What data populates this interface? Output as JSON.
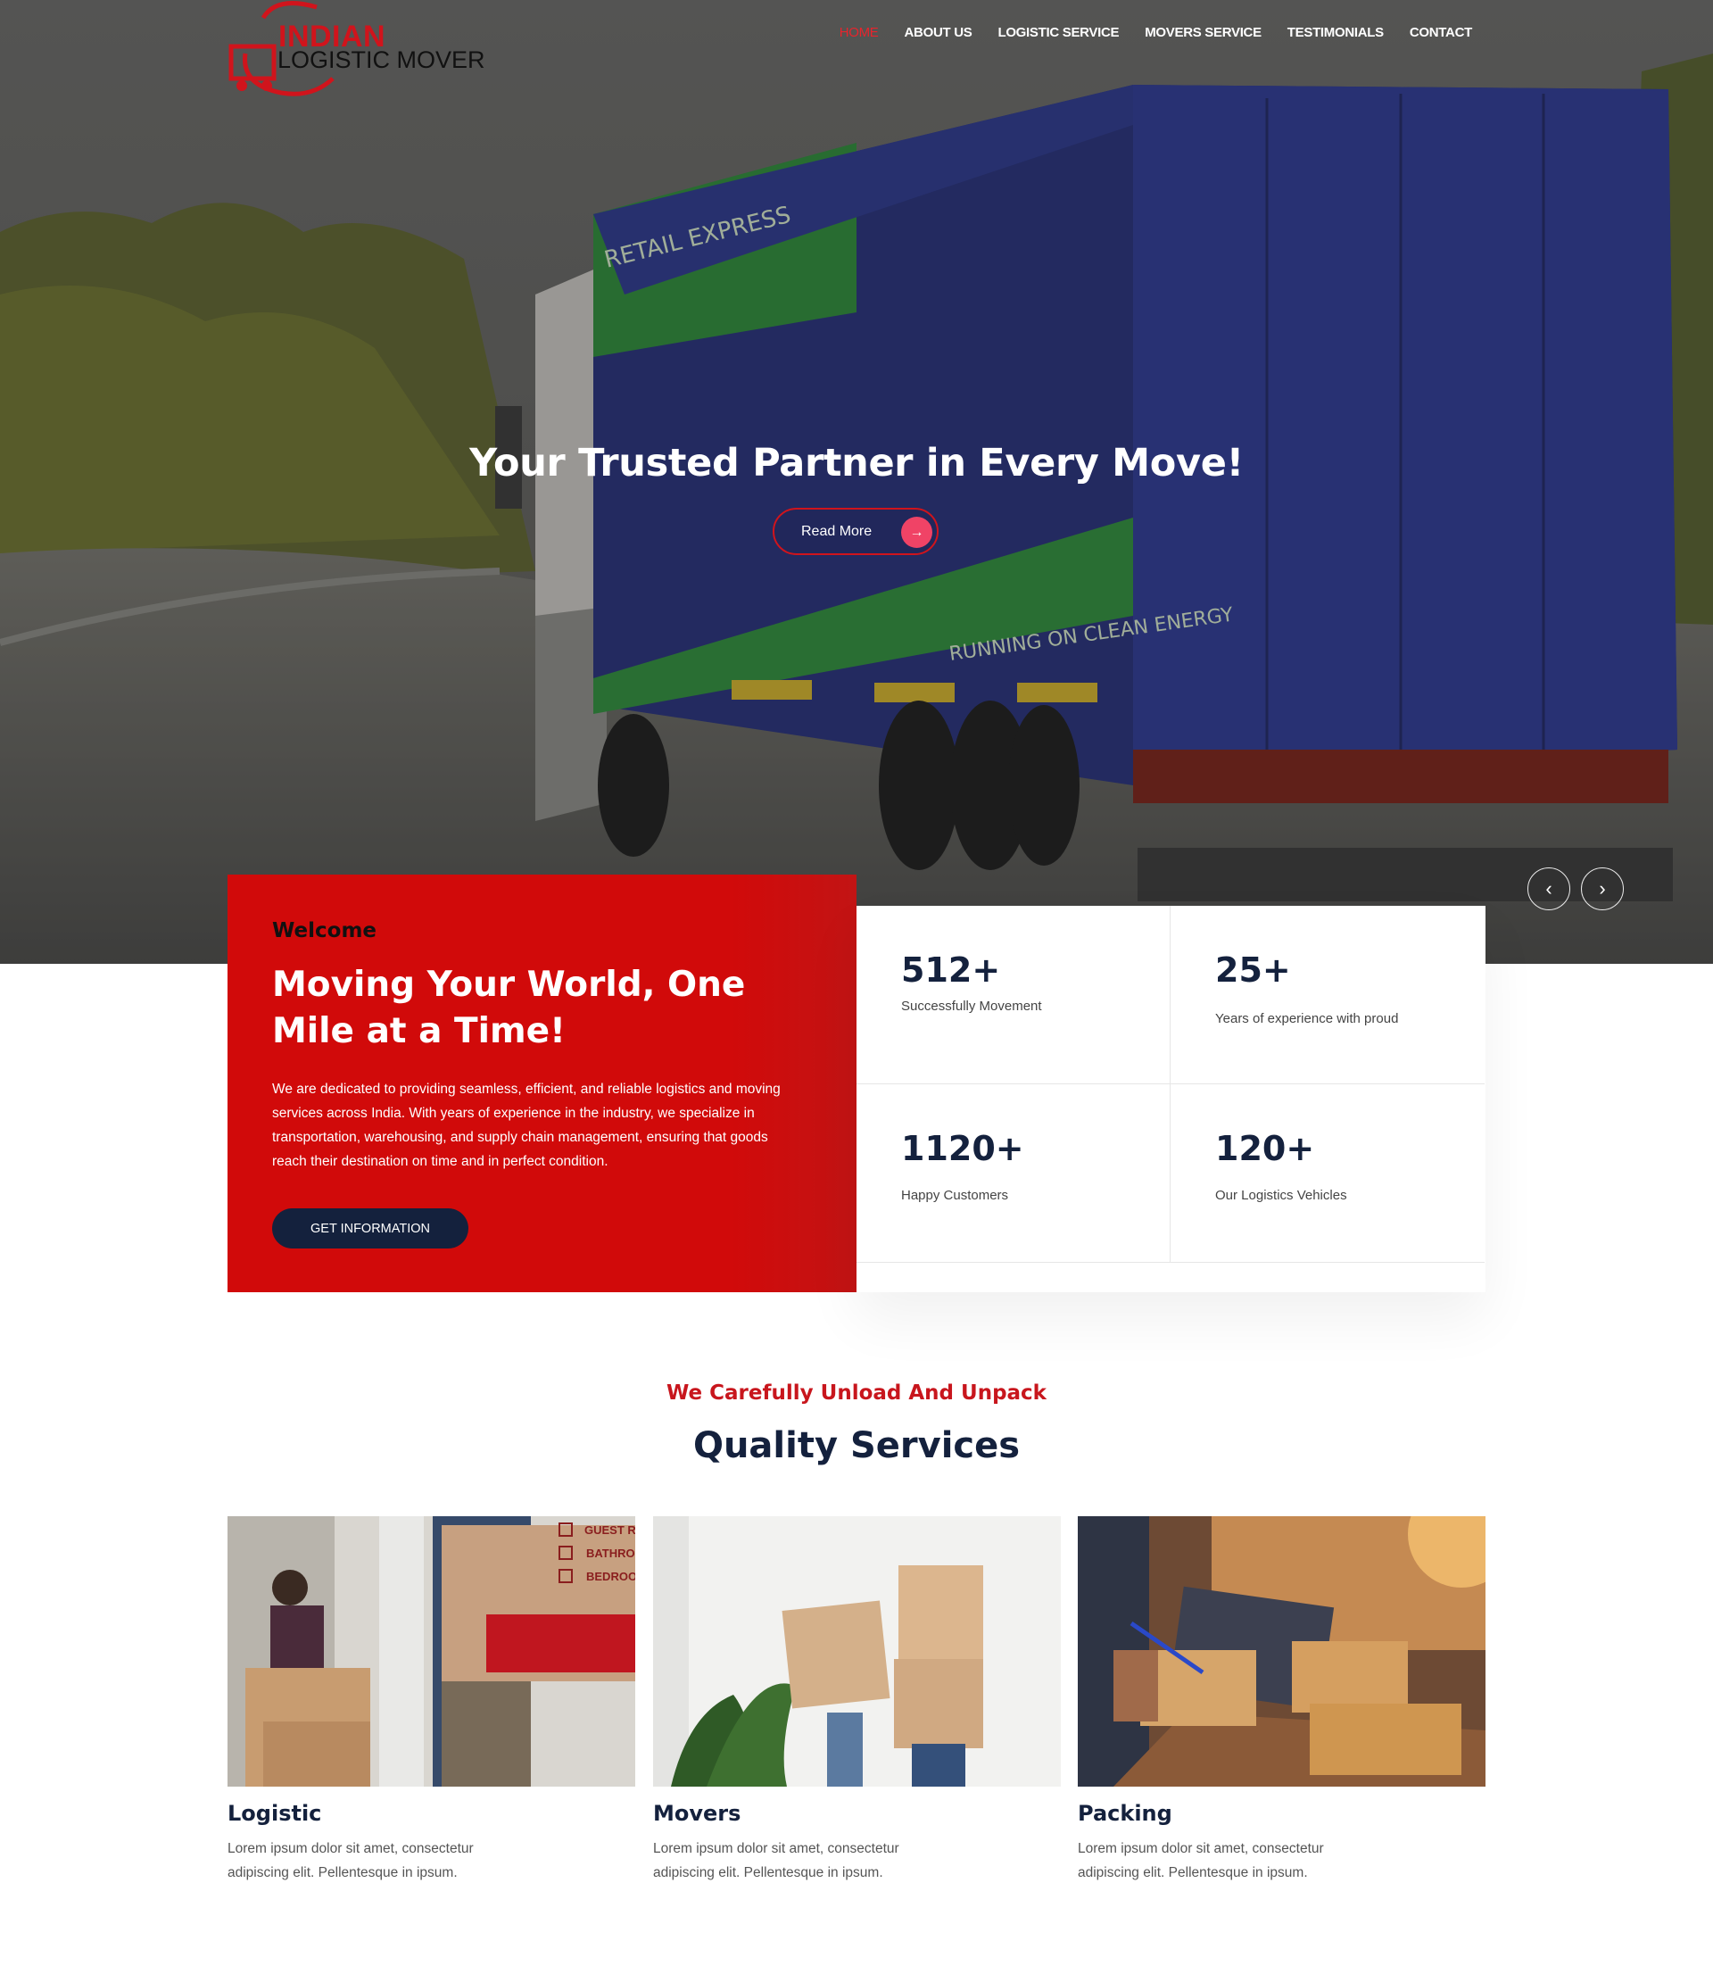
{
  "brand": {
    "name_line1": "INDIAN",
    "name_line2": "LOGISTIC MOVER",
    "accent": "#d0141c",
    "dark": "#14213d"
  },
  "nav": {
    "items": [
      {
        "label": "HOME",
        "active": true
      },
      {
        "label": "ABOUT US"
      },
      {
        "label": "LOGISTIC SERVICE"
      },
      {
        "label": "MOVERS SERVICE"
      },
      {
        "label": "TESTIMONIALS"
      },
      {
        "label": "CONTACT"
      }
    ]
  },
  "hero": {
    "title": "Your Trusted Partner in Every Move!",
    "cta_label": "Read More",
    "cta_icon": "arrow-right-icon",
    "truck_text_1": "RETAIL EXPRESS",
    "truck_text_2": "RUNNING ON CLEAN ENERGY",
    "prev_icon": "chevron-left-icon",
    "next_icon": "chevron-right-icon"
  },
  "welcome": {
    "label": "Welcome",
    "title": "Moving Your World, One Mile at a Time!",
    "text": "We are dedicated to providing seamless, efficient, and reliable logistics and moving services across India. With years of experience in the industry, we specialize in transportation, warehousing, and supply chain management, ensuring that goods reach their destination on time and in perfect condition.",
    "button": "GET INFORMATION"
  },
  "stats": [
    {
      "value": "512+",
      "label": "Successfully Movement"
    },
    {
      "value": "25+",
      "label": "Years of experience with proud"
    },
    {
      "value": "1120+",
      "label": "Happy Customers"
    },
    {
      "value": "120+",
      "label": "Our Logistics Vehicles"
    }
  ],
  "services": {
    "kicker": "We Carefully Unload And Unpack",
    "title": "Quality Services",
    "cards": [
      {
        "title": "Logistic",
        "text": "Lorem ipsum dolor sit amet, consectetur adipiscing elit. Pellentesque in ipsum.",
        "checklist": [
          "GUEST R",
          "BATHRO",
          "BEDROO"
        ]
      },
      {
        "title": "Movers",
        "text": "Lorem ipsum dolor sit amet, consectetur adipiscing elit. Pellentesque in ipsum."
      },
      {
        "title": "Packing",
        "text": "Lorem ipsum dolor sit amet, consectetur adipiscing elit. Pellentesque in ipsum."
      }
    ]
  }
}
